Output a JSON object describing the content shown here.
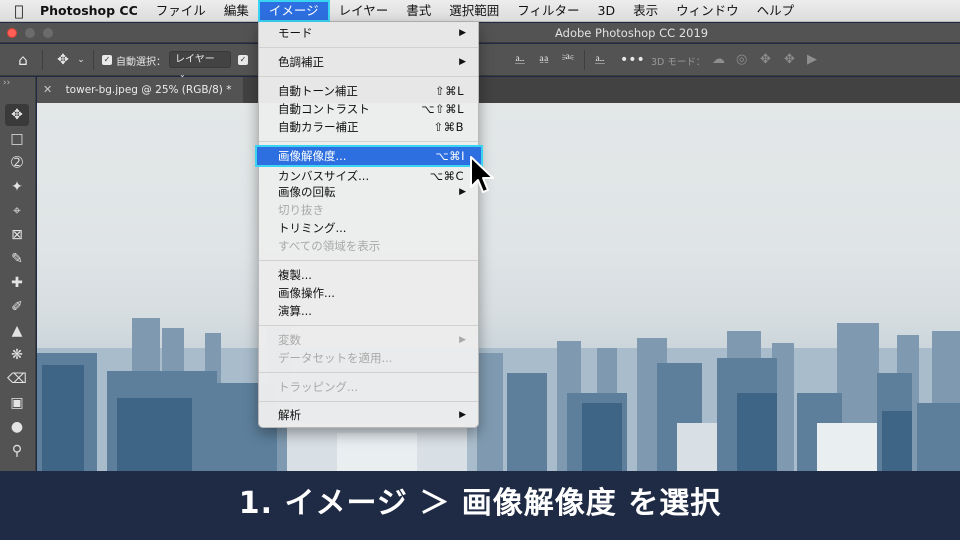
{
  "menubar": {
    "app_name": "Photoshop CC",
    "items": [
      "ファイル",
      "編集",
      "イメージ",
      "レイヤー",
      "書式",
      "選択範囲",
      "フィルター",
      "3D",
      "表示",
      "ウィンドウ",
      "ヘルプ"
    ],
    "active_item": "イメージ"
  },
  "window": {
    "title": "Adobe Photoshop CC 2019"
  },
  "options_bar": {
    "auto_select_label": "自動選択：",
    "auto_select_value": "レイヤー",
    "mode_3d_label": "3D モード："
  },
  "document": {
    "tab_title": "tower-bg.jpeg @ 25% (RGB/8) *"
  },
  "image_menu": {
    "mode": "モード",
    "adjustments": "色調補正",
    "auto_tone": {
      "label": "自動トーン補正",
      "shortcut": "⇧⌘L"
    },
    "auto_contrast": {
      "label": "自動コントラスト",
      "shortcut": "⌥⇧⌘L"
    },
    "auto_color": {
      "label": "自動カラー補正",
      "shortcut": "⇧⌘B"
    },
    "image_size": {
      "label": "画像解像度...",
      "shortcut": "⌥⌘I"
    },
    "canvas_size": {
      "label": "カンバスサイズ...",
      "shortcut": "⌥⌘C"
    },
    "image_rotation": "画像の回転",
    "crop": "切り抜き",
    "trim": "トリミング...",
    "reveal_all": "すべての領域を表示",
    "duplicate": "複製...",
    "apply_image": "画像操作...",
    "calculations": "演算...",
    "variables": "変数",
    "apply_data_set": "データセットを適用...",
    "trap": "トラッピング...",
    "analysis": "解析"
  },
  "caption": {
    "text": "1. イメージ ＞ 画像解像度 を選択"
  },
  "colors": {
    "menu_highlight": "#2d6fe0",
    "highlight_outline": "#3ad3f2",
    "caption_bg": "#1f2a44"
  }
}
